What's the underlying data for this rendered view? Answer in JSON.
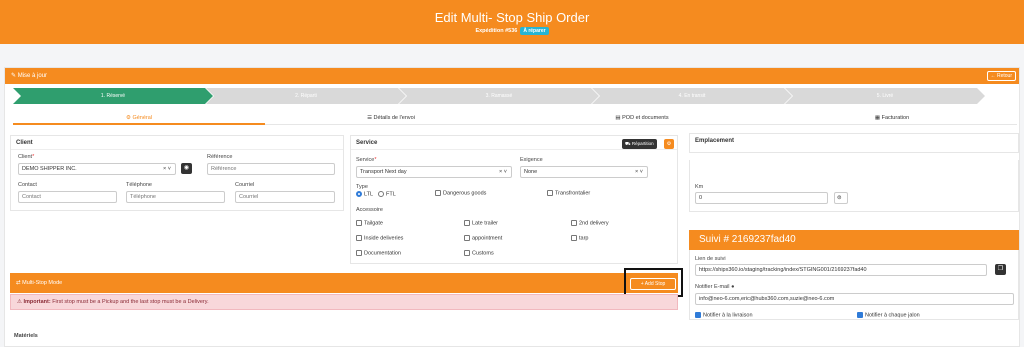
{
  "header": {
    "title": "Edit Multi- Stop Ship Order",
    "subtitle": "Expédition #536",
    "badge": "À réparer"
  },
  "toolbar": {
    "label": "Mise à jour",
    "back_label": "← Retour"
  },
  "steps": [
    "1. Réservé",
    "2. Réparti",
    "3. Ramassé",
    "4. En transit",
    "5. Livré"
  ],
  "tabs": [
    {
      "label": "Général",
      "icon": "gear-icon"
    },
    {
      "label": "Détails de l'envoi",
      "icon": "list-icon"
    },
    {
      "label": "POD et documents",
      "icon": "document-icon"
    },
    {
      "label": "Facturation",
      "icon": "invoice-icon"
    }
  ],
  "client": {
    "title": "Client",
    "client_label": "Client",
    "client_value": "DEMO SHIPPER INC.",
    "reference_label": "Référence",
    "reference_placeholder": "Référence",
    "contact_label": "Contact",
    "contact_placeholder": "Contact",
    "telephone_label": "Téléphone",
    "telephone_placeholder": "Téléphone",
    "courriel_label": "Courriel",
    "courriel_placeholder": "Courriel"
  },
  "service": {
    "title": "Service",
    "repartition_label": "Répartition",
    "service_label": "Service",
    "service_value": "Transport Next day",
    "exigence_label": "Exigence",
    "exigence_value": "None",
    "type_label": "Type",
    "type_ltl": "LTL",
    "type_ftl": "FTL",
    "dangerous_goods": "Dangerous goods",
    "transfrontalier": "Transfrontalier",
    "accessoire_label": "Accessoire",
    "accessories": [
      "Tailgate",
      "Late trailer",
      "2nd delivery",
      "Inside deliveries",
      "appointment",
      "tarp",
      "Documentation",
      "Customs"
    ]
  },
  "emplacement": {
    "title": "Emplacement",
    "km_label": "Km",
    "km_value": "0"
  },
  "suivi": {
    "title": "Suivi # 2169237fad40",
    "lien_label": "Lien de suivi",
    "lien_value": "https://shipx360.io/staging/tracking/index/STGING001/2169237fad40",
    "notifier_email_label": "Notifier E-mail",
    "emails_value": "info@neo-6.com,eric@hubx360.com,suzie@neo-6.com",
    "notifier_livraison": "Notifier à la livraison",
    "notifier_jalon": "Notifier à chaque jalon"
  },
  "multistop": {
    "title": "Multi-Stop Mode",
    "add_stop": "+ Add Stop",
    "alert_strong": "Important:",
    "alert_text": " First stop must be a Pickup and the last stop must be a Delivery."
  },
  "footer": {
    "cut_label": "Matériels"
  }
}
